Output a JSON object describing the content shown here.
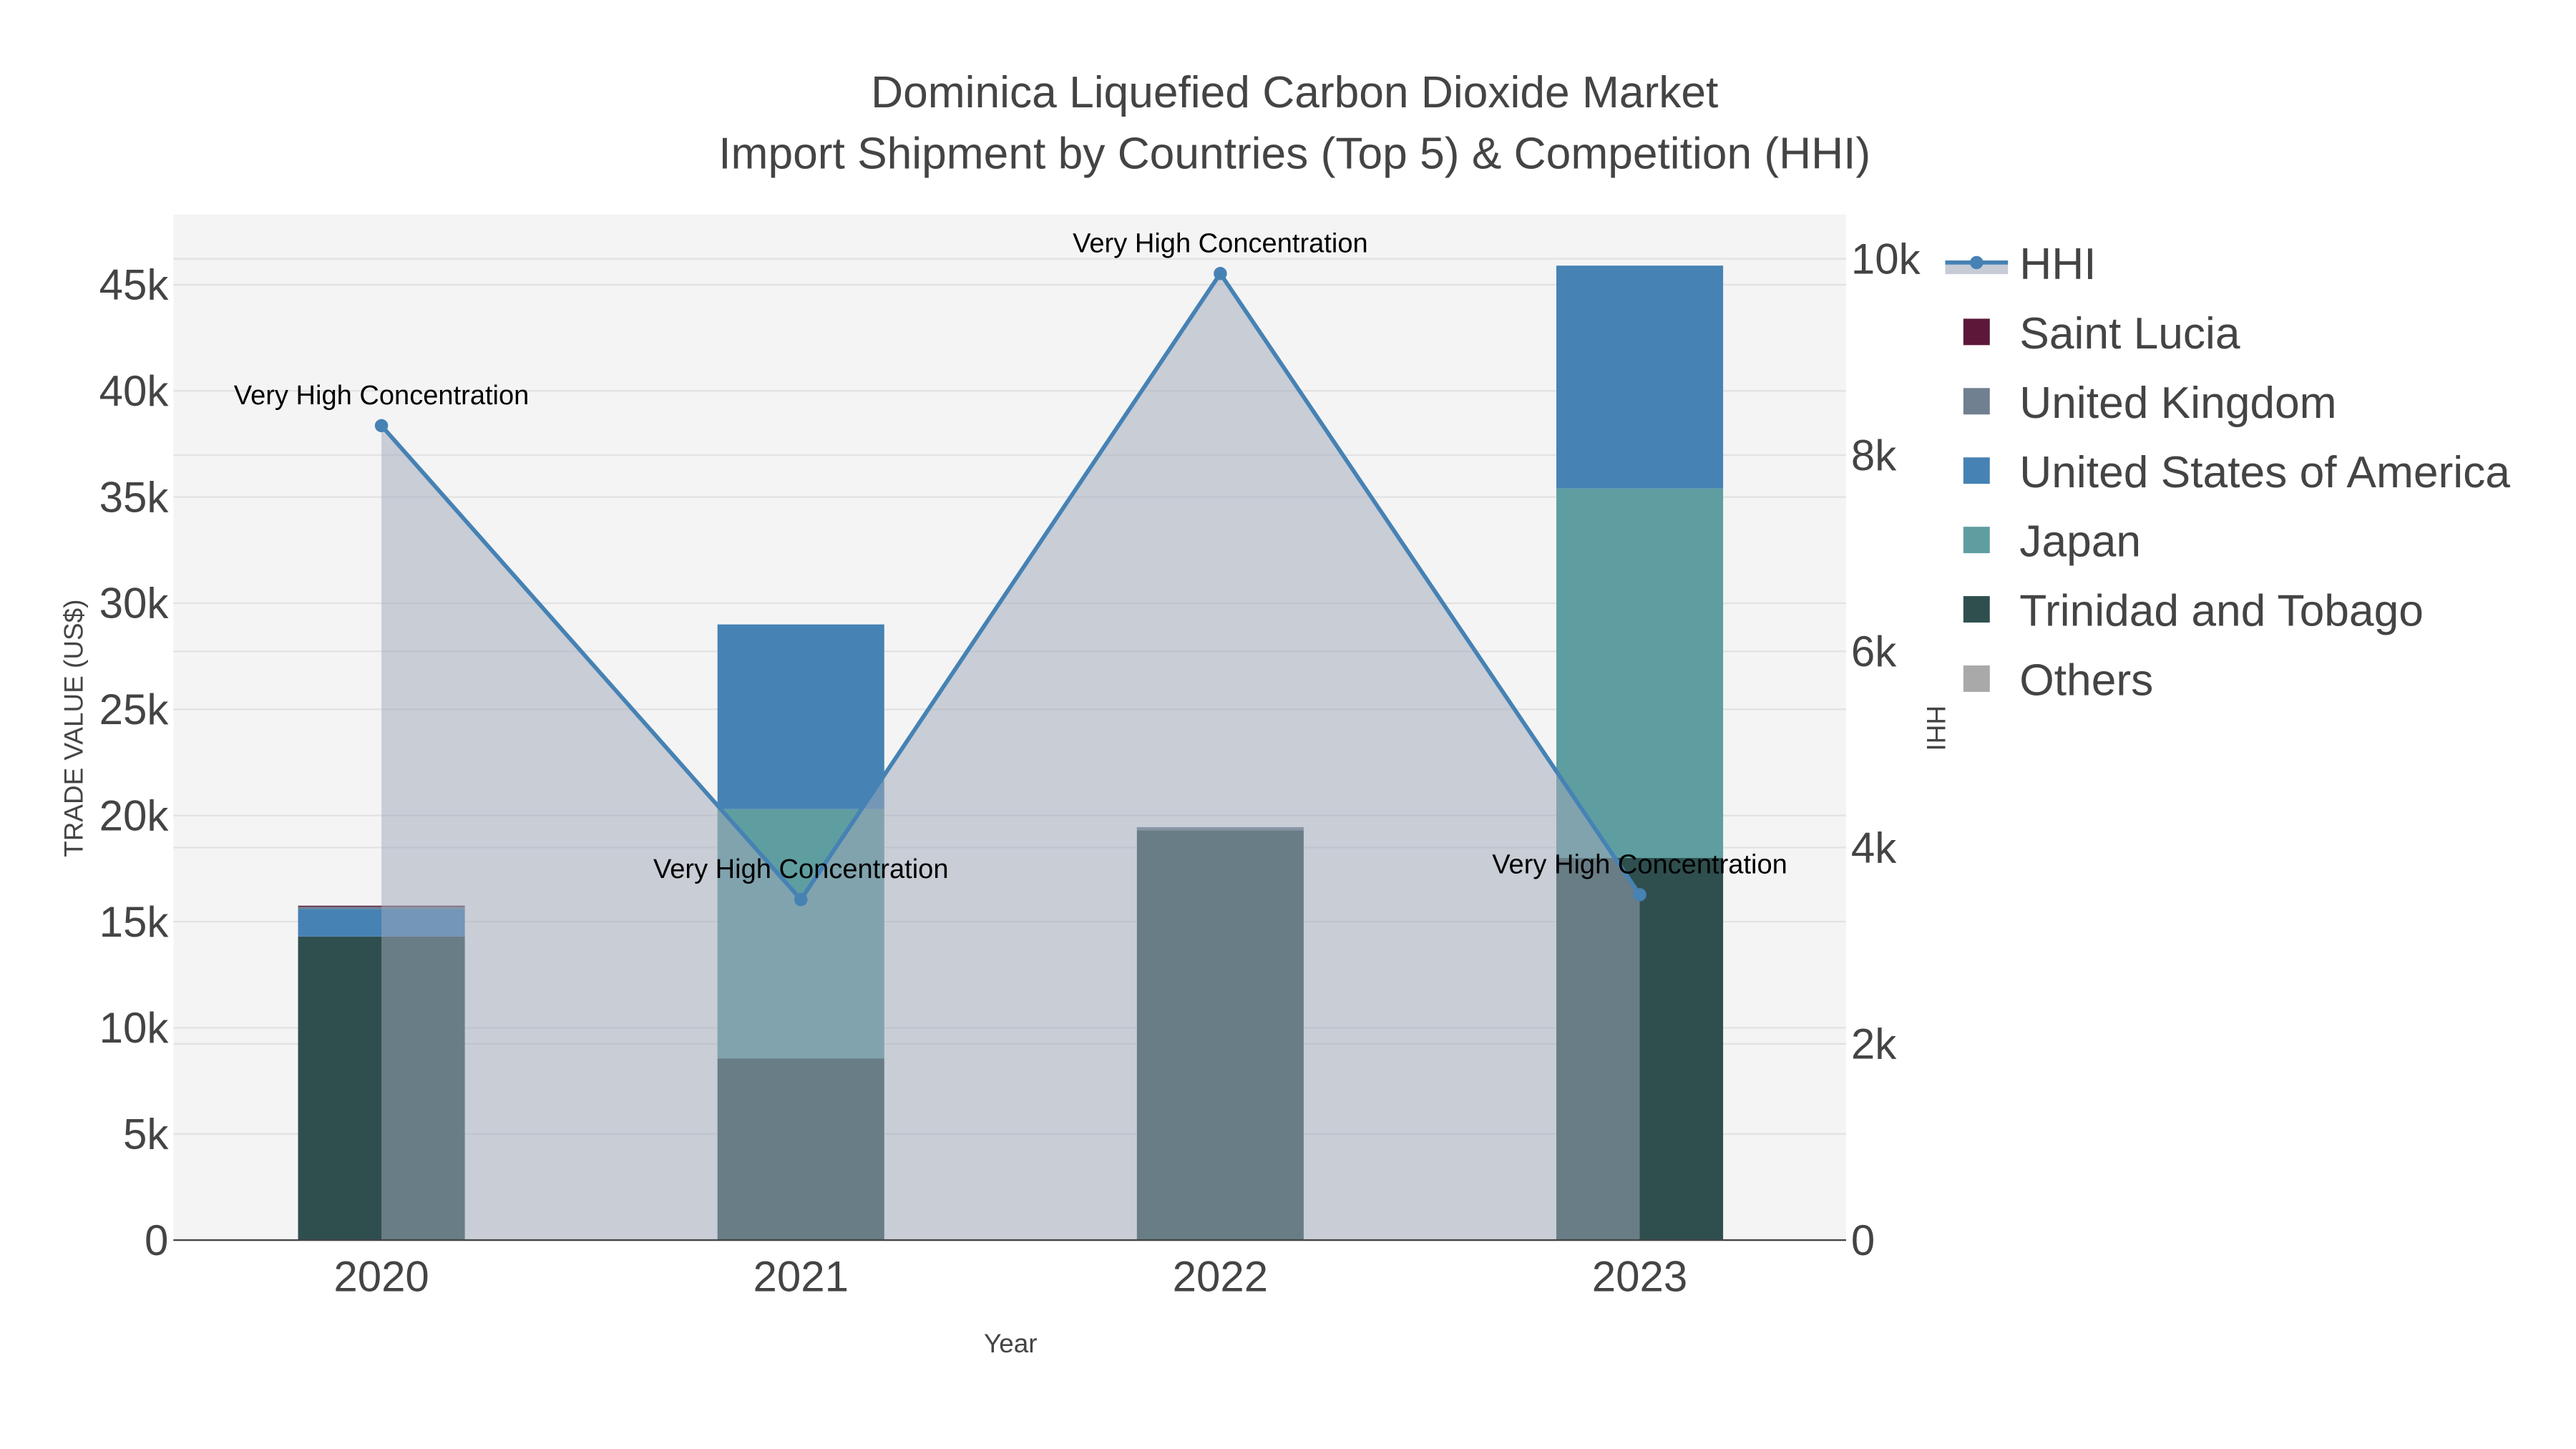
{
  "chart_data": {
    "type": "bar",
    "title": [
      "Dominica Liquefied Carbon Dioxide Market",
      "Import Shipment by Countries (Top 5) & Competition (HHI)"
    ],
    "xlabel": "Year",
    "ylabel": "TRADE VALUE (US$)",
    "y2label": "HHI",
    "categories": [
      "2020",
      "2021",
      "2022",
      "2023"
    ],
    "ylim": [
      0,
      48300
    ],
    "y2lim": [
      0,
      10450
    ],
    "yticks": [
      {
        "v": 0,
        "l": "0"
      },
      {
        "v": 5000,
        "l": "5k"
      },
      {
        "v": 10000,
        "l": "10k"
      },
      {
        "v": 15000,
        "l": "15k"
      },
      {
        "v": 20000,
        "l": "20k"
      },
      {
        "v": 25000,
        "l": "25k"
      },
      {
        "v": 30000,
        "l": "30k"
      },
      {
        "v": 35000,
        "l": "35k"
      },
      {
        "v": 40000,
        "l": "40k"
      },
      {
        "v": 45000,
        "l": "45k"
      }
    ],
    "y2ticks": [
      {
        "v": 0,
        "l": "0"
      },
      {
        "v": 2000,
        "l": "2k"
      },
      {
        "v": 4000,
        "l": "4k"
      },
      {
        "v": 6000,
        "l": "6k"
      },
      {
        "v": 8000,
        "l": "8k"
      },
      {
        "v": 10000,
        "l": "10k"
      }
    ],
    "grid": true,
    "legend_placement": "right",
    "series": [
      {
        "name": "Trinidad and Tobago",
        "color": "#2f4f4f",
        "values": [
          14300,
          8560,
          19300,
          18000
        ]
      },
      {
        "name": "Japan",
        "color": "#5f9ea0",
        "values": [
          0,
          11740,
          0,
          17400
        ]
      },
      {
        "name": "United States of America",
        "color": "#4682b4",
        "values": [
          1300,
          8700,
          0,
          10500
        ]
      },
      {
        "name": "United Kingdom",
        "color": "#708090",
        "values": [
          100,
          0,
          150,
          0
        ]
      },
      {
        "name": "Saint Lucia",
        "color": "#5c1838",
        "values": [
          50,
          0,
          0,
          0
        ]
      },
      {
        "name": "Others",
        "color": "#a9a9a9",
        "values": [
          0,
          0,
          0,
          0
        ]
      }
    ],
    "hhi": {
      "name": "HHI",
      "color": "#4682b4",
      "values": [
        8300,
        3470,
        9850,
        3520
      ],
      "annotations": [
        "Very High Concentration",
        "Very High Concentration",
        "Very High Concentration",
        "Very High Concentration"
      ]
    },
    "legend": [
      "HHI",
      "Saint Lucia",
      "United Kingdom",
      "United States of America",
      "Japan",
      "Trinidad and Tobago",
      "Others"
    ]
  }
}
